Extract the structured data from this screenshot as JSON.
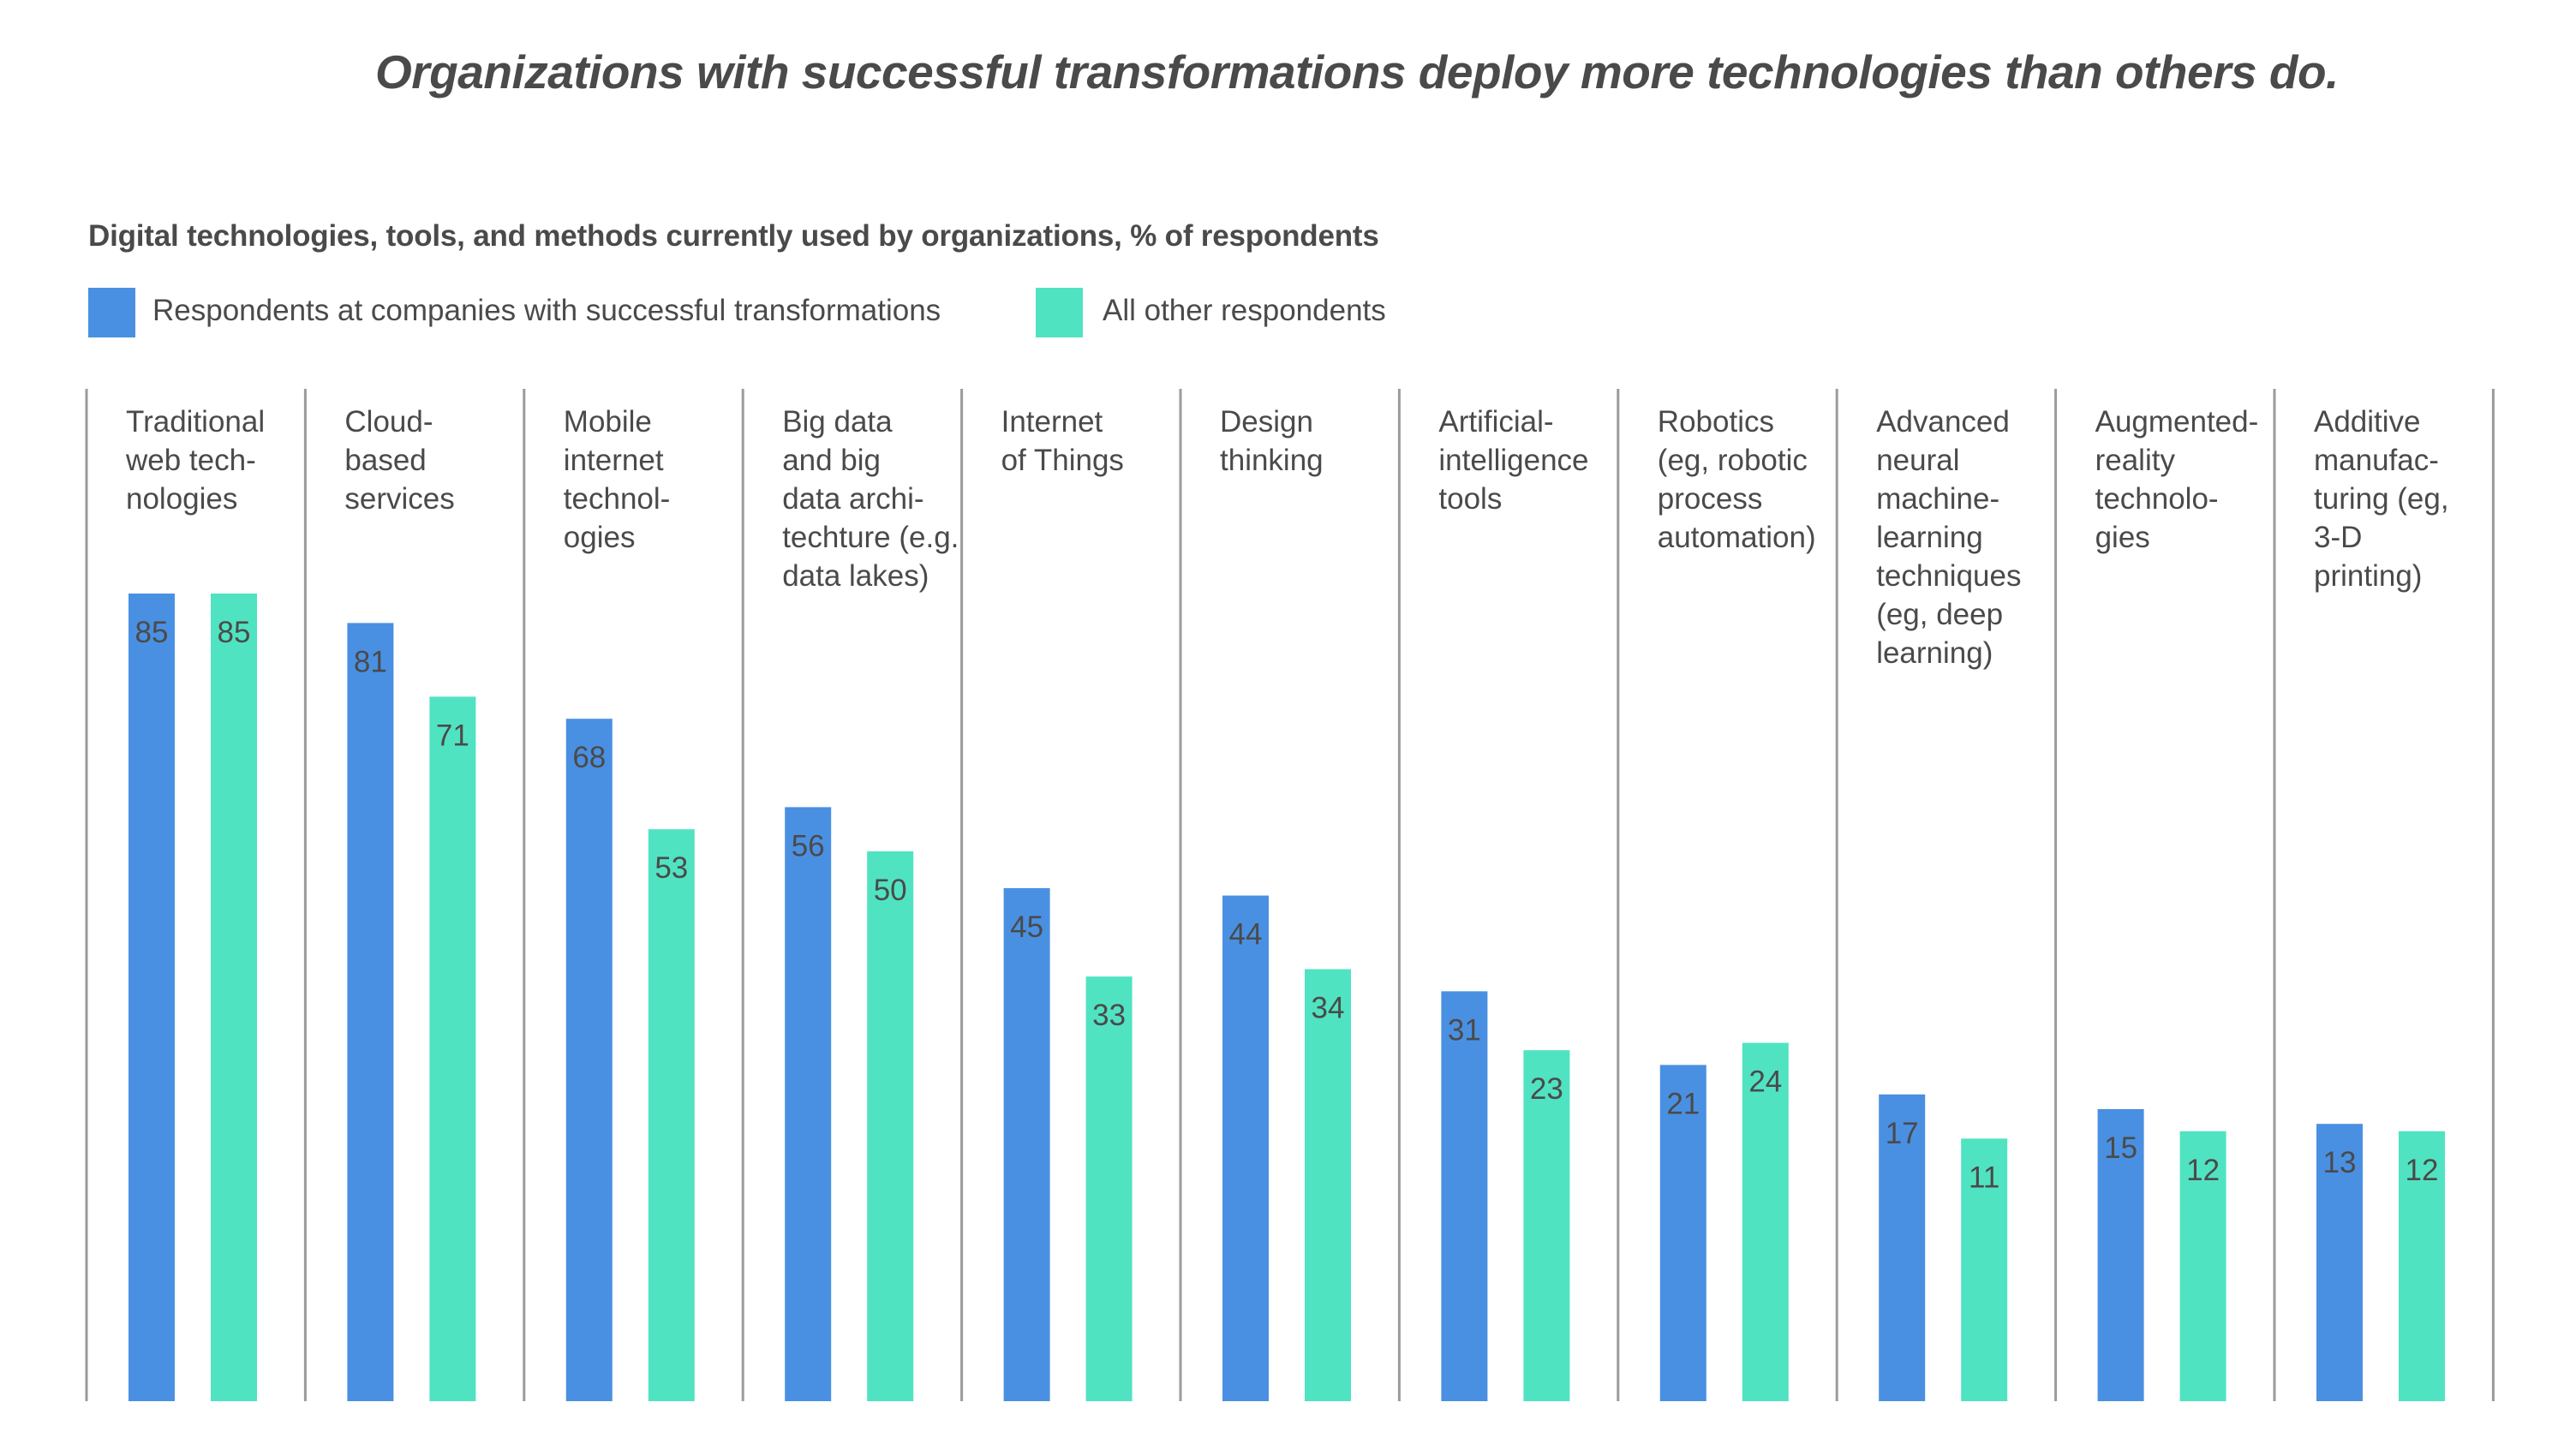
{
  "title": "Organizations with successful transformations deploy more technologies than others do.",
  "chart_data": {
    "type": "bar",
    "title": "Organizations with successful transformations deploy more technologies than others do.",
    "subtitle": "Digital technologies, tools, and methods currently used by organizations, % of respondents",
    "xlabel": "",
    "ylabel": "% of respondents",
    "ylim": [
      0,
      100
    ],
    "grid": false,
    "legend_position": "top-left",
    "categories": [
      "Traditional\nweb tech-\nnologies",
      "Cloud-\nbased\nservices",
      "Mobile\ninternet\ntechnol-\nogies",
      "Big data\nand big\ndata archi-\ntechture (e.g.\ndata lakes)",
      "Internet\nof Things",
      "Design\nthinking",
      "Artificial-\nintelligence\ntools",
      "Robotics\n(eg, robotic\nprocess\nautomation)",
      "Advanced\nneural\nmachine-\nlearning\ntechniques\n(eg, deep\nlearning)",
      "Augmented-\nreality\ntechnolo-\ngies",
      "Additive\nmanufac-\nturing (eg,\n3-D\nprinting)"
    ],
    "series": [
      {
        "name": "Respondents at companies with successful transformations",
        "color": "#4A90E2",
        "values": [
          85,
          81,
          68,
          56,
          45,
          44,
          31,
          21,
          17,
          15,
          13
        ]
      },
      {
        "name": "All other respondents",
        "color": "#50E3C2",
        "values": [
          85,
          71,
          53,
          50,
          33,
          34,
          23,
          24,
          11,
          12,
          12
        ]
      }
    ]
  },
  "colors": {
    "text": "#4A4A4A",
    "divider": "#9B9B9B"
  }
}
